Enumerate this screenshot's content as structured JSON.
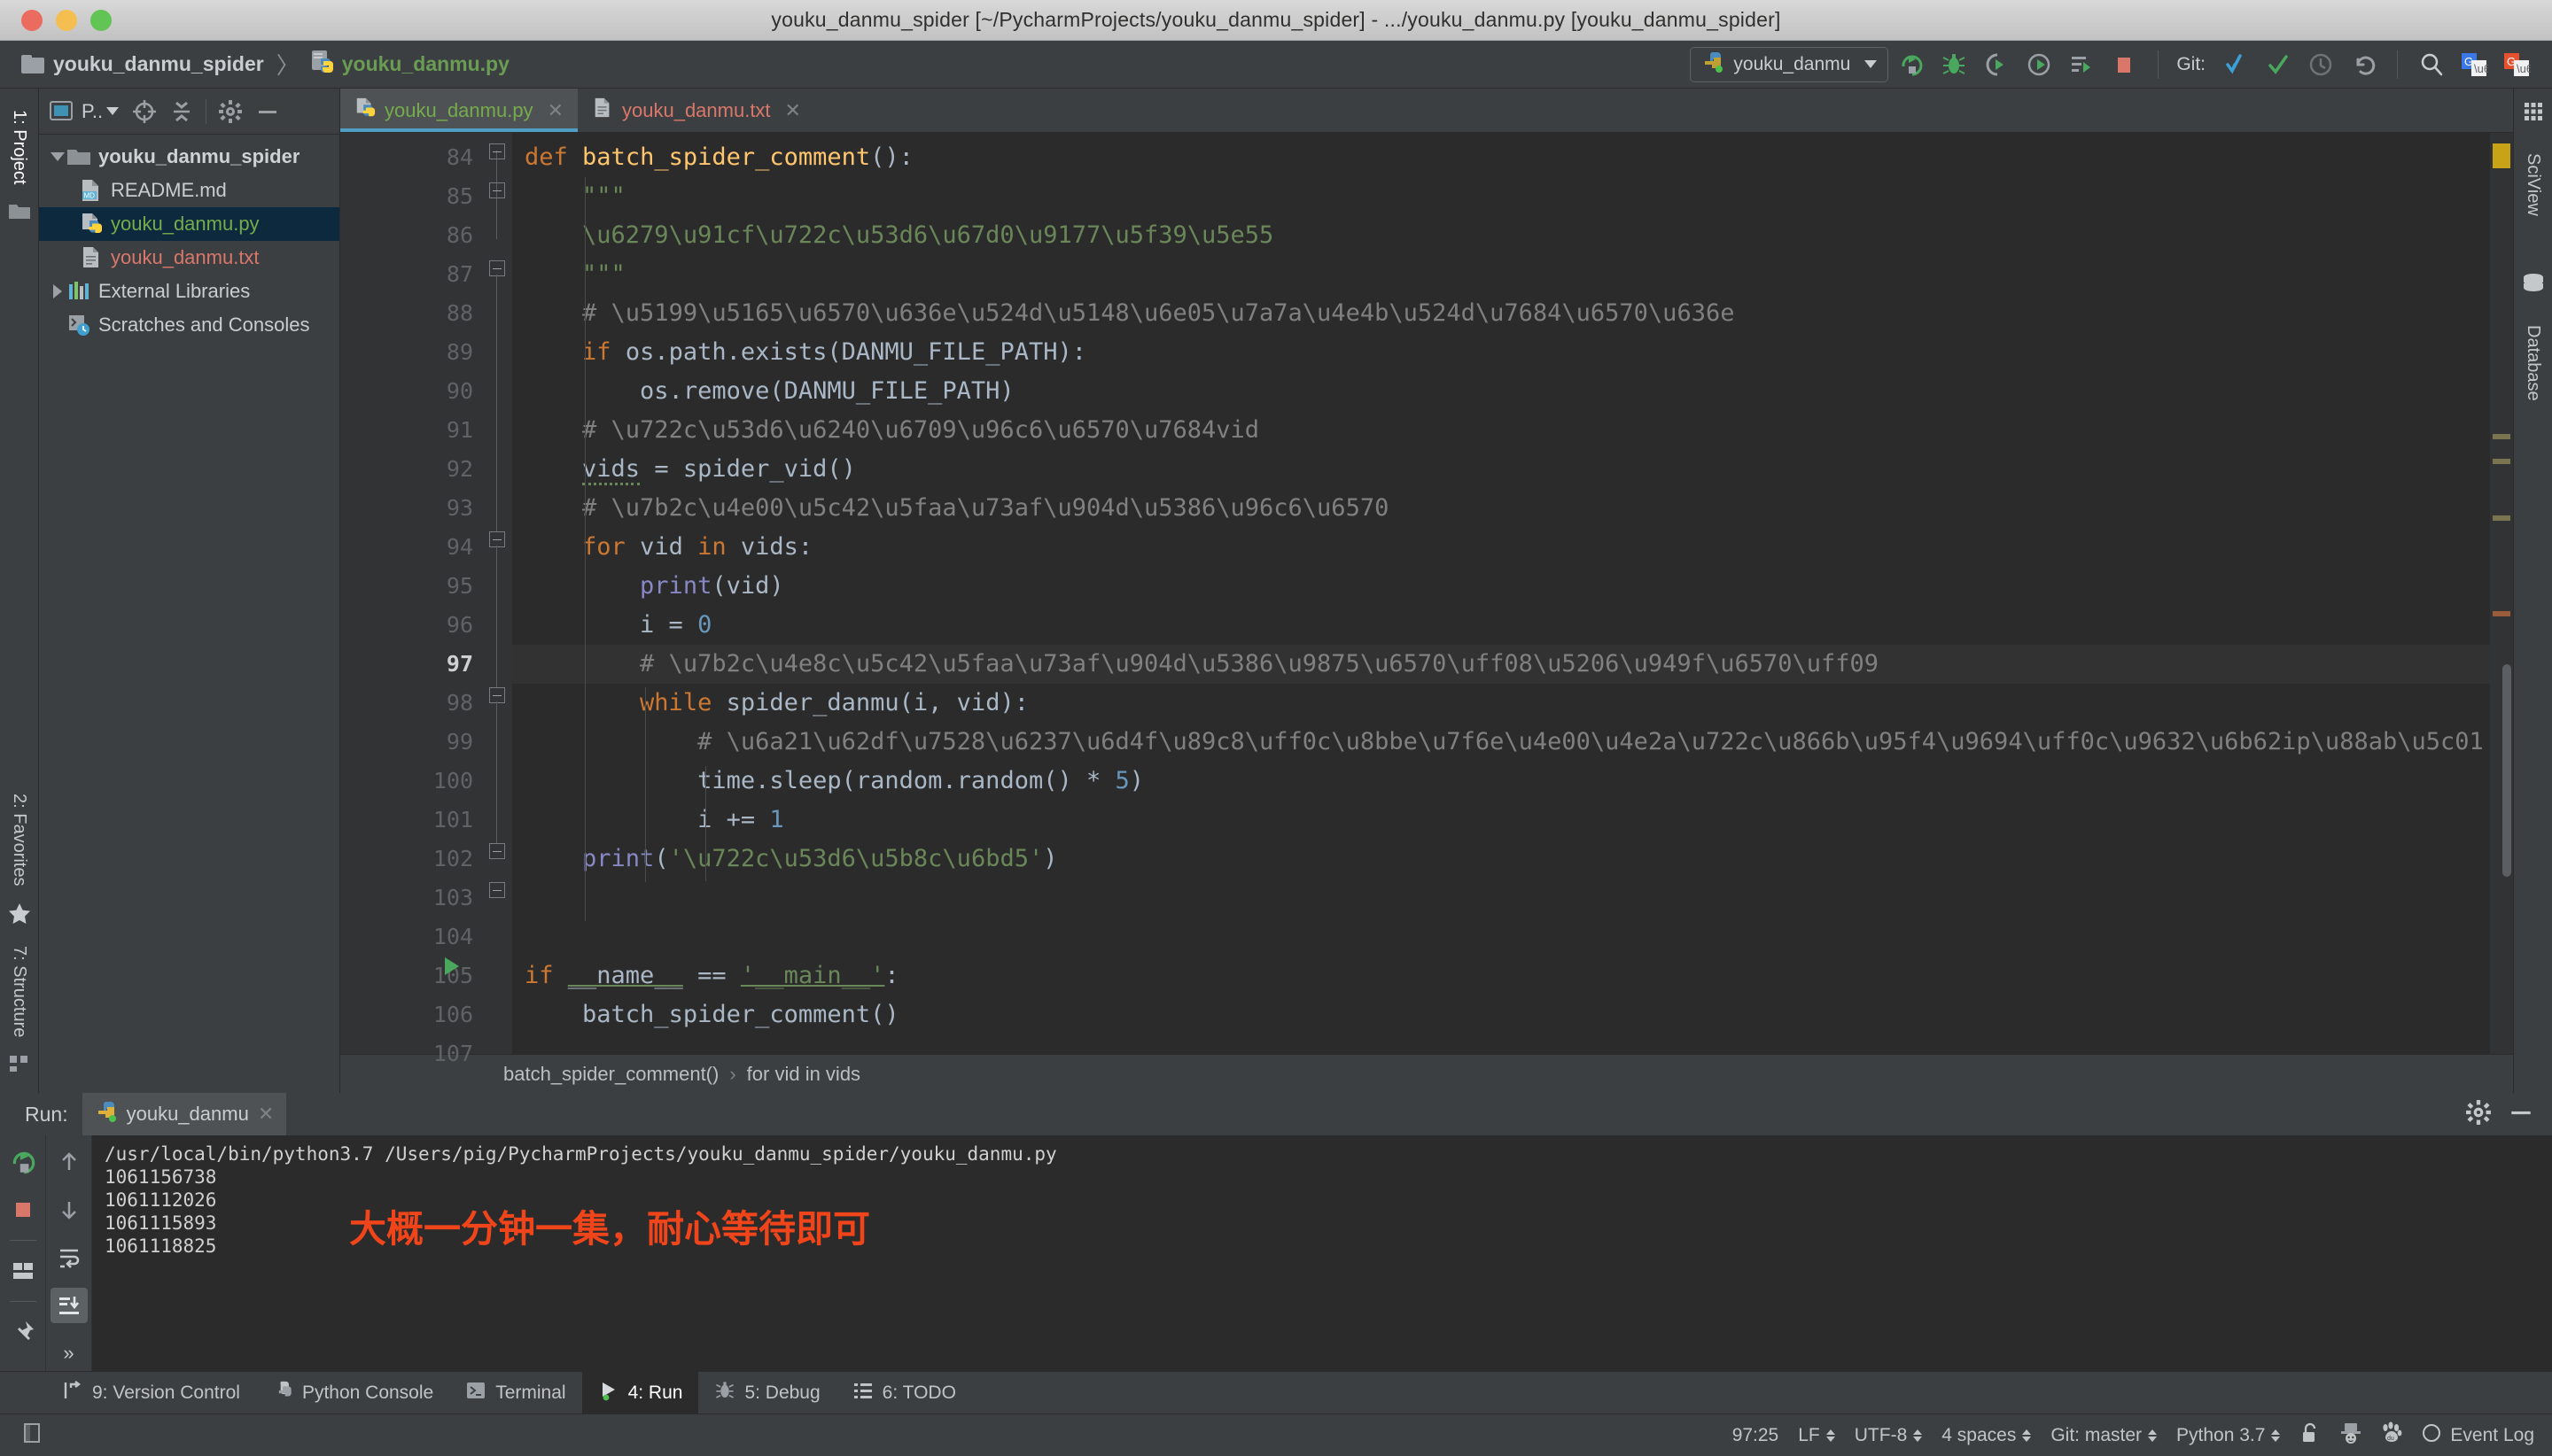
{
  "window": {
    "title": "youku_danmu_spider [~/PycharmProjects/youku_danmu_spider] - .../youku_danmu.py [youku_danmu_spider]"
  },
  "navbar": {
    "crumbs": [
      {
        "label": "youku_danmu_spider",
        "icon": "folder-icon"
      },
      {
        "label": "youku_danmu.py",
        "icon": "python-file-icon"
      }
    ],
    "separator": "〉",
    "run_config": {
      "name": "youku_danmu",
      "icon": "python-config-icon"
    },
    "git_label": "Git:",
    "buttons": [
      {
        "name": "run-button",
        "icon": "run-arrow-icon"
      },
      {
        "name": "debug-button",
        "icon": "bug-icon"
      },
      {
        "name": "run-coverage-button",
        "icon": "coverage-icon"
      },
      {
        "name": "profile-button",
        "icon": "profile-icon"
      },
      {
        "name": "run-with-console-button",
        "icon": "console-run-icon"
      },
      {
        "name": "stop-button",
        "icon": "stop-square-icon"
      },
      {
        "name": "git-update-button",
        "icon": "update-arrow-icon"
      },
      {
        "name": "git-commit-button",
        "icon": "checkmark-icon"
      },
      {
        "name": "git-history-button",
        "icon": "clock-icon"
      },
      {
        "name": "git-rollback-button",
        "icon": "undo-icon"
      },
      {
        "name": "search-everywhere-button",
        "icon": "search-icon"
      },
      {
        "name": "google-translate-button",
        "icon": "translate-blue-icon"
      },
      {
        "name": "translate-button",
        "icon": "translate-red-icon"
      }
    ]
  },
  "left_strip": {
    "tabs": [
      {
        "label": "1: Project",
        "number": "1",
        "active": true
      },
      {
        "label": "2: Favorites",
        "number": "2",
        "active": false
      },
      {
        "label": "7: Structure",
        "number": "7",
        "active": false
      }
    ]
  },
  "project_panel": {
    "toolbar": {
      "selector_label": "P..",
      "buttons": [
        {
          "name": "project-view-selector",
          "icon": "project-window-icon"
        },
        {
          "name": "scroll-from-source-button",
          "icon": "target-icon"
        },
        {
          "name": "collapse-all-button",
          "icon": "collapse-icon"
        },
        {
          "name": "settings-button",
          "icon": "gear-icon"
        },
        {
          "name": "hide-button",
          "icon": "minus-icon"
        }
      ]
    },
    "tree": [
      {
        "label": "youku_danmu_spider",
        "icon": "folder-icon",
        "expander": "down",
        "style": "bold",
        "indent": 0,
        "selected": false
      },
      {
        "label": "README.md",
        "icon": "markdown-file-icon",
        "expander": "none",
        "style": "normal",
        "indent": 1,
        "selected": false
      },
      {
        "label": "youku_danmu.py",
        "icon": "python-file-icon",
        "expander": "none",
        "style": "green",
        "indent": 1,
        "selected": true
      },
      {
        "label": "youku_danmu.txt",
        "icon": "text-file-icon",
        "expander": "none",
        "style": "red",
        "indent": 1,
        "selected": false
      },
      {
        "label": "External Libraries",
        "icon": "libraries-icon",
        "expander": "right",
        "style": "normal",
        "indent": 0,
        "selected": false
      },
      {
        "label": "Scratches and Consoles",
        "icon": "scratches-icon",
        "expander": "none",
        "style": "normal",
        "indent": 0,
        "selected": false
      }
    ]
  },
  "editor": {
    "tabs": [
      {
        "label": "youku_danmu.py",
        "icon": "python-file-icon",
        "kind": "py",
        "active": true,
        "close": "✕"
      },
      {
        "label": "youku_danmu.txt",
        "icon": "text-file-icon",
        "kind": "txt",
        "active": false,
        "close": "✕"
      }
    ],
    "first_line_number": 84,
    "current_line": 97,
    "run_marker_line": 105,
    "lines": [
      {
        "n": 84,
        "text": "def batch_spider_comment():"
      },
      {
        "n": 85,
        "text": "    \"\"\""
      },
      {
        "n": 86,
        "text": "    批量爬取某酷弹幕"
      },
      {
        "n": 87,
        "text": "    \"\"\""
      },
      {
        "n": 88,
        "text": "    # 写入数据前先清空之前的数据"
      },
      {
        "n": 89,
        "text": "    if os.path.exists(DANMU_FILE_PATH):"
      },
      {
        "n": 90,
        "text": "        os.remove(DANMU_FILE_PATH)"
      },
      {
        "n": 91,
        "text": "    # 爬取所有集数的vid"
      },
      {
        "n": 92,
        "text": "    vids = spider_vid()"
      },
      {
        "n": 93,
        "text": "    # 第一层循环遍历集数"
      },
      {
        "n": 94,
        "text": "    for vid in vids:"
      },
      {
        "n": 95,
        "text": "        print(vid)"
      },
      {
        "n": 96,
        "text": "        i = 0"
      },
      {
        "n": 97,
        "text": "        # 第二层循环遍历页数（分钟数）"
      },
      {
        "n": 98,
        "text": "        while spider_danmu(i, vid):"
      },
      {
        "n": 99,
        "text": "            # 模拟用户浏览，设置一个爬虫间隔，防止ip被封"
      },
      {
        "n": 100,
        "text": "            time.sleep(random.random() * 5)"
      },
      {
        "n": 101,
        "text": "            i += 1"
      },
      {
        "n": 102,
        "text": "    print('爬取完毕')"
      },
      {
        "n": 103,
        "text": ""
      },
      {
        "n": 104,
        "text": ""
      },
      {
        "n": 105,
        "text": "if __name__ == '__main__':"
      },
      {
        "n": 106,
        "text": "    batch_spider_comment()"
      },
      {
        "n": 107,
        "text": ""
      }
    ],
    "breadcrumb": {
      "function": "batch_spider_comment()",
      "separator": "›",
      "scope": "for vid in vids"
    }
  },
  "right_strip": {
    "tabs": [
      {
        "label": "SciView",
        "icon": "sciview-grid-icon"
      },
      {
        "label": "Database",
        "icon": "database-icon"
      }
    ]
  },
  "run_window": {
    "label": "Run:",
    "tab": {
      "label": "youku_danmu",
      "icon": "python-config-icon",
      "close": "✕"
    },
    "header_buttons": [
      {
        "name": "run-settings-button",
        "icon": "gear-icon"
      },
      {
        "name": "hide-run-window-button",
        "icon": "minus-icon"
      }
    ],
    "tool_buttons": [
      {
        "name": "rerun-button",
        "icon": "rerun-icon"
      },
      {
        "name": "stop-process-button",
        "icon": "stop-square-icon"
      },
      {
        "name": "show-running-list-button",
        "icon": "layout-icon"
      },
      {
        "name": "pin-tab-button",
        "icon": "pin-icon"
      },
      {
        "name": "up-stacktrace-button",
        "icon": "arrow-up-icon"
      },
      {
        "name": "down-stacktrace-button",
        "icon": "arrow-down-icon"
      },
      {
        "name": "soft-wrap-button",
        "icon": "wrap-icon"
      },
      {
        "name": "scroll-to-end-button",
        "icon": "scroll-end-icon"
      },
      {
        "name": "more-button",
        "icon": "chevron-double-right-icon"
      }
    ],
    "more_label": "»",
    "console": {
      "lines": [
        "/usr/local/bin/python3.7 /Users/pig/PycharmProjects/youku_danmu_spider/youku_danmu.py",
        "1061156738",
        "1061112026",
        "1061115893",
        "1061118825"
      ],
      "annotation": "大概一分钟一集，耐心等待即可",
      "annotation_color": "#f0441a"
    }
  },
  "bottom_bar": {
    "items": [
      {
        "label": "9: Version Control",
        "number": "9",
        "icon": "version-control-icon",
        "active": false
      },
      {
        "label": "Python Console",
        "number": "",
        "icon": "python-console-icon",
        "active": false
      },
      {
        "label": "Terminal",
        "number": "",
        "icon": "terminal-icon",
        "active": false
      },
      {
        "label": "4: Run",
        "number": "4",
        "icon": "run-arrow-icon",
        "active": true
      },
      {
        "label": "5: Debug",
        "number": "5",
        "icon": "bug-icon",
        "active": false
      },
      {
        "label": "6: TODO",
        "number": "6",
        "icon": "todo-list-icon",
        "active": false
      }
    ]
  },
  "status_bar": {
    "left_icon": "toggle-toolbar-icon",
    "caret_position": "97:25",
    "line_separator": "LF",
    "encoding": "UTF-8",
    "indent": "4 spaces",
    "branch": "Git: master",
    "interpreter": "Python 3.7",
    "lock_icon": "unlock-icon",
    "inspector_icon": "inspector-hat-icon",
    "baidu_icon": "baidu-paw-icon",
    "event_log": "Event Log",
    "event_log_icon": "event-log-icon"
  }
}
